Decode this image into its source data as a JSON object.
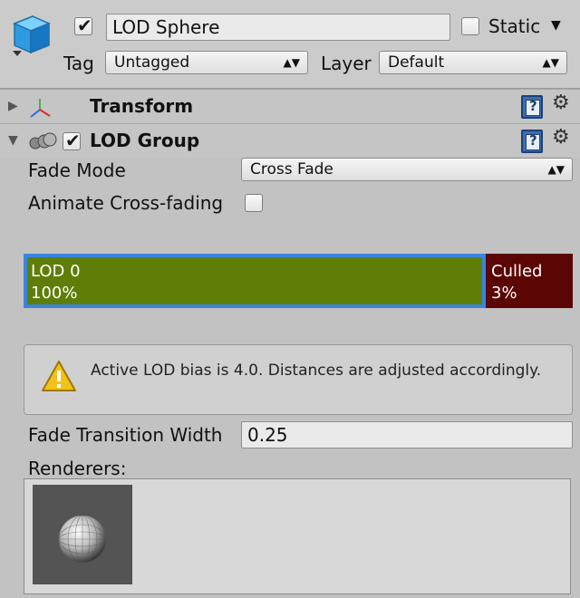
{
  "header": {
    "object_name": "LOD Sphere",
    "active_checked": true,
    "static_label": "Static",
    "static_checked": false,
    "tag_label": "Tag",
    "tag_value": "Untagged",
    "layer_label": "Layer",
    "layer_value": "Default",
    "icon": "gameobject-cube-icon"
  },
  "components": {
    "transform": {
      "title": "Transform",
      "icon": "transform-axes-icon"
    },
    "lod_group": {
      "title": "LOD Group",
      "enabled": true,
      "icon": "lod-group-icon"
    }
  },
  "lod_group": {
    "fade_mode_label": "Fade Mode",
    "fade_mode_value": "Cross Fade",
    "animate_cross_fading_label": "Animate Cross-fading",
    "animate_cross_fading_checked": false,
    "levels": [
      {
        "name": "LOD 0",
        "percent": "100%",
        "color": "#5e7e07"
      },
      {
        "name": "Culled",
        "percent": "3%",
        "color": "#5c0505"
      }
    ],
    "warning_text": "Active LOD bias is 4.0. Distances are adjusted accordingly.",
    "fade_transition_width_label": "Fade Transition Width",
    "fade_transition_width_value": "0.25",
    "renderers_label": "Renderers:"
  },
  "colors": {
    "selection_outline": "#3a84e0",
    "help_icon": "#3b6fb4",
    "warning_icon": "#f2c21a"
  }
}
